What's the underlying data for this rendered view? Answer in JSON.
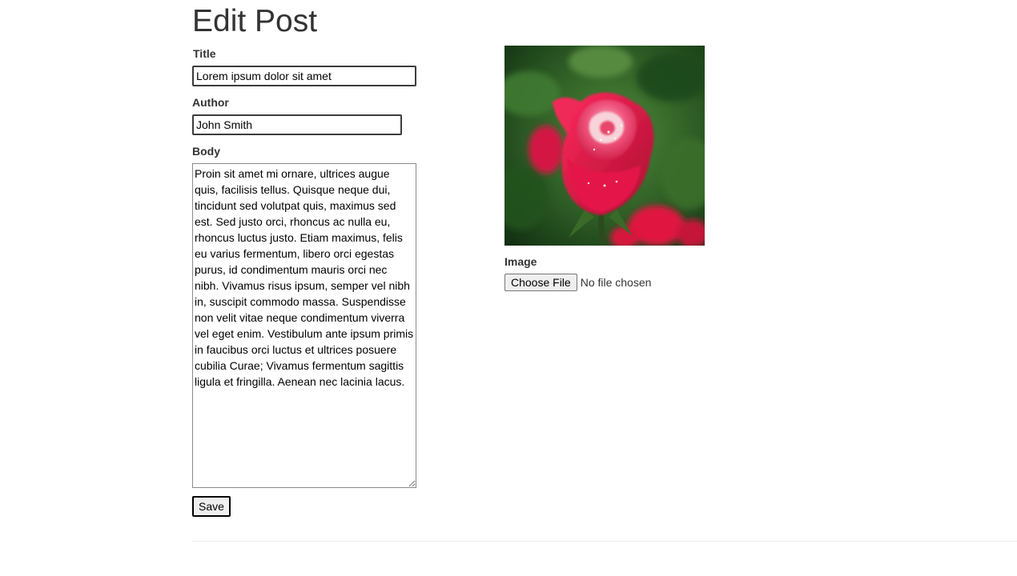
{
  "page": {
    "title": "Edit Post"
  },
  "form": {
    "title_label": "Title",
    "title_value": "Lorem ipsum dolor sit amet",
    "author_label": "Author",
    "author_value": "John Smith",
    "body_label": "Body",
    "body_value": "Proin sit amet mi ornare, ultrices augue quis, facilisis tellus. Quisque neque dui, tincidunt sed volutpat quis, maximus sed est. Sed justo orci, rhoncus ac nulla eu, rhoncus luctus justo. Etiam maximus, felis eu varius fermentum, libero orci egestas purus, id condimentum mauris orci nec nibh. Vivamus risus ipsum, semper vel nibh in, suscipit commodo massa. Suspendisse non velit vitae neque condimentum viverra vel eget enim. Vestibulum ante ipsum primis in faucibus orci luctus et ultrices posuere cubilia Curae; Vivamus fermentum sagittis ligula et fringilla. Aenean nec lacinia lacus.",
    "save_label": "Save"
  },
  "image_section": {
    "image_label": "Image",
    "choose_file_label": "Choose File",
    "file_status": "No file chosen"
  },
  "colors": {
    "rose": "#e0194a",
    "foliage": "#2f6a2a",
    "text": "#333333"
  }
}
